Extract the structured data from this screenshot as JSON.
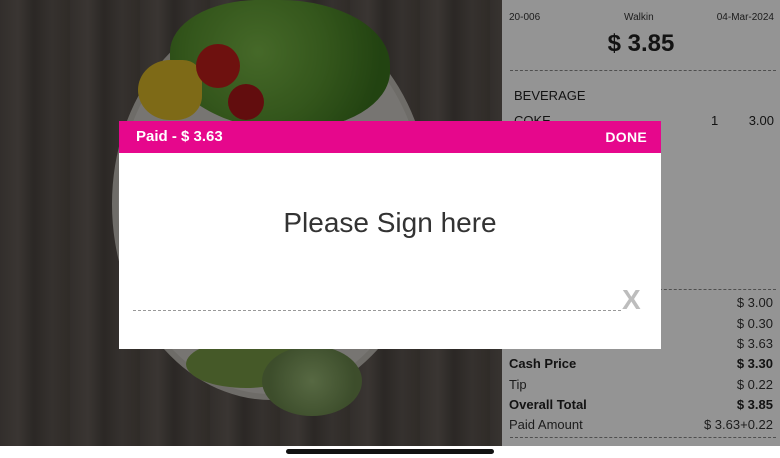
{
  "receipt": {
    "order_id": "20-006",
    "order_type": "Walkin",
    "date": "04-Mar-2024",
    "total": "$ 3.85",
    "category": "BEVERAGE",
    "items": [
      {
        "name": "COKE",
        "qty": "1",
        "price": "3.00"
      }
    ],
    "summary": [
      {
        "label": "",
        "value": "$ 3.00"
      },
      {
        "label": "",
        "value": "$ 0.30"
      },
      {
        "label": "",
        "value": "$ 3.63"
      },
      {
        "label": "Cash Price",
        "value": "$ 3.30"
      },
      {
        "label": "Tip",
        "value": "$ 0.22"
      },
      {
        "label": "Overall Total",
        "value": "$ 3.85"
      },
      {
        "label": "Paid Amount",
        "value": "$ 3.63+0.22"
      }
    ]
  },
  "modal": {
    "paid_label": "Paid - $ 3.63",
    "done_label": "DONE",
    "title": "Please Sign here",
    "clear_label": "X"
  },
  "colors": {
    "accent": "#e6078c",
    "overlay": "rgba(0,0,0,0.45)"
  }
}
